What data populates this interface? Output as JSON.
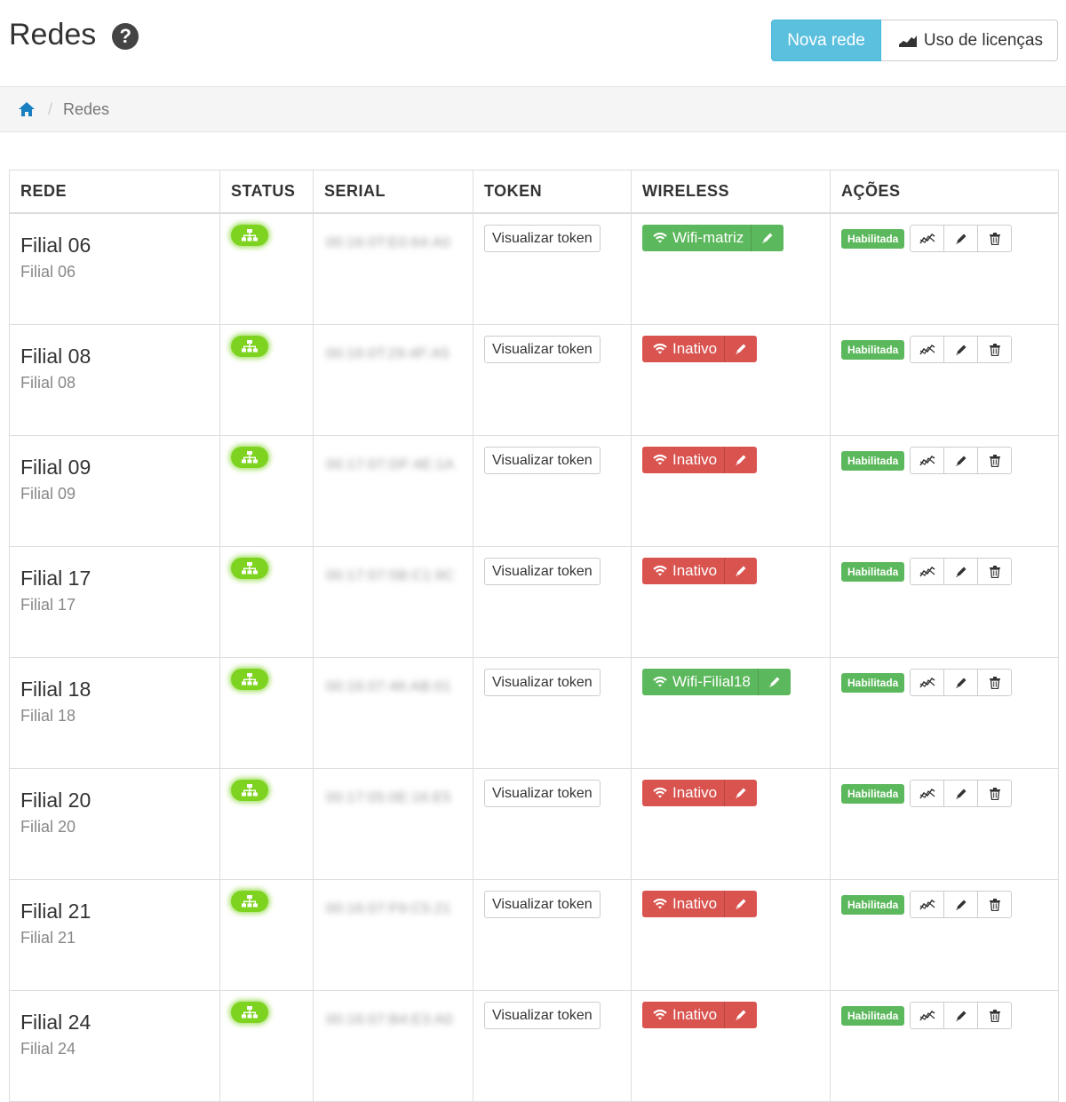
{
  "header": {
    "title": "Redes",
    "new_label": "Nova rede",
    "license_label": "Uso de licenças"
  },
  "breadcrumb": {
    "current": "Redes"
  },
  "table": {
    "columns": [
      "REDE",
      "STATUS",
      "SERIAL",
      "TOKEN",
      "WIRELESS",
      "AÇÕES"
    ],
    "token_label": "Visualizar token",
    "enabled_label": "Habilitada",
    "rows": [
      {
        "name": "Filial 06",
        "sub": "Filial 06",
        "serial": "00:16:0T:E0:64:A0",
        "wireless": "Wifi-matriz",
        "wireless_state": "active"
      },
      {
        "name": "Filial 08",
        "sub": "Filial 08",
        "serial": "00:16:0T:29:4F:A5",
        "wireless": "Inativo",
        "wireless_state": "inactive"
      },
      {
        "name": "Filial 09",
        "sub": "Filial 09",
        "serial": "00:17:07:DF:4E:1A",
        "wireless": "Inativo",
        "wireless_state": "inactive"
      },
      {
        "name": "Filial 17",
        "sub": "Filial 17",
        "serial": "00:17:07:5B:C1:9C",
        "wireless": "Inativo",
        "wireless_state": "inactive"
      },
      {
        "name": "Filial 18",
        "sub": "Filial 18",
        "serial": "00:16:07:46:AB:01",
        "wireless": "Wifi-Filial18",
        "wireless_state": "active"
      },
      {
        "name": "Filial 20",
        "sub": "Filial 20",
        "serial": "00:17:05:0E:16:E5",
        "wireless": "Inativo",
        "wireless_state": "inactive"
      },
      {
        "name": "Filial 21",
        "sub": "Filial 21",
        "serial": "00:16:07:F9:C5:21",
        "wireless": "Inativo",
        "wireless_state": "inactive"
      },
      {
        "name": "Filial 24",
        "sub": "Filial 24",
        "serial": "00:16:07:B4:E3:A0",
        "wireless": "Inativo",
        "wireless_state": "inactive"
      }
    ]
  },
  "colors": {
    "primary_button": "#5bc0de",
    "status_online": "#7ed321",
    "wireless_active": "#5cb85c",
    "wireless_inactive": "#d9534f",
    "enabled_badge": "#5cb85c",
    "home_icon": "#1a7fc1"
  },
  "icons": {
    "help": "question-circle-icon",
    "license": "area-chart-icon",
    "home": "home-icon",
    "status": "network-tree-icon",
    "wifi": "wifi-icon",
    "edit": "pencil-icon",
    "stats": "line-chart-icon",
    "delete": "trash-icon"
  }
}
